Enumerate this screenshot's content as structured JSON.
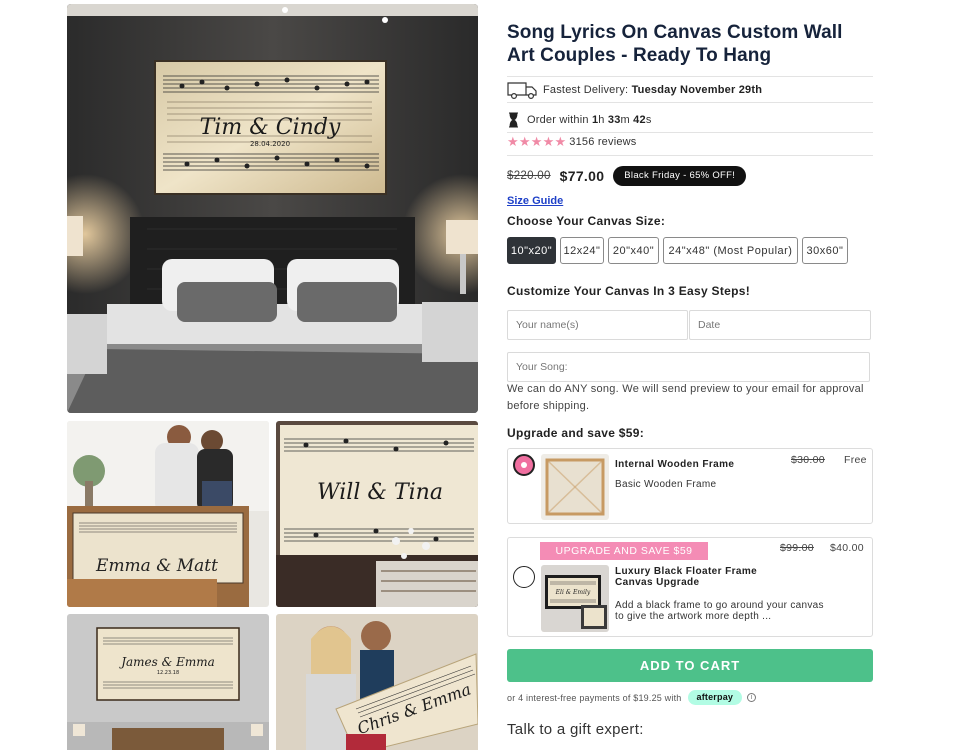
{
  "product": {
    "title": "Song Lyrics On Canvas Custom Wall Art Couples - Ready To Hang",
    "delivery": {
      "label": "Fastest Delivery:",
      "date": "Tuesday November 29th"
    },
    "order_timer": {
      "prefix": "Order within",
      "hours": "1",
      "h": "h",
      "minutes": "33",
      "m": "m",
      "seconds": "42",
      "s": "s"
    },
    "rating": {
      "stars": 5,
      "count_text": "3156 reviews"
    },
    "price": {
      "old": "$220.00",
      "new": "$77.00",
      "badge": "Black Friday - 65% OFF!"
    },
    "size_guide": "Size Guide",
    "size_label": "Choose Your Canvas Size:",
    "sizes": [
      "10\"x20\"",
      "12x24\"",
      "20\"x40\"",
      "24\"x48\" (Most Popular)",
      "30x60\""
    ],
    "selected_size": "10\"x20\"",
    "customize_label": "Customize Your Canvas In 3 Easy Steps!",
    "inputs": {
      "name_placeholder": "Your name(s)",
      "date_placeholder": "Date",
      "song_placeholder": "Your Song:"
    },
    "note": "We can do ANY song. We will send preview to your email for approval before shipping.",
    "upgrade_label": "Upgrade and save $59:",
    "upgrades": [
      {
        "title": "Internal Wooden Frame",
        "desc": "Basic Wooden Frame",
        "old_price": "$30.00",
        "new_price": "Free",
        "selected": true
      },
      {
        "ribbon": "UPGRADE AND SAVE $59",
        "title": "Luxury Black Floater Frame Canvas Upgrade",
        "desc": "Add a black frame to go around your canvas to give the artwork more depth ...",
        "old_price": "$99.00",
        "new_price": "$40.00",
        "selected": false
      }
    ],
    "add_to_cart": "ADD TO CART",
    "afterpay": {
      "text": "or 4 interest-free payments of $19.25 with",
      "badge": "afterpay",
      "info": "i"
    },
    "gift_expert": "Talk to a gift expert:"
  },
  "gallery": {
    "main_names": "Tim & Cindy",
    "main_date": "28.04.2020",
    "thumbs": [
      {
        "names": "Emma & Matt"
      },
      {
        "names": "Will & Tina"
      },
      {
        "names": "James & Emma",
        "date": "12.23.18"
      },
      {
        "names": "Chris & Emma"
      }
    ],
    "upgrade_thumb_names": "Eli & Emily"
  },
  "colors": {
    "accent_green": "#4dc18a",
    "pink": "#f48cb5",
    "title_navy": "#16233b",
    "badge_black": "#111111",
    "afterpay_mint": "#b2fce4"
  },
  "icons": [
    "truck-icon",
    "hourglass-icon",
    "star-icon",
    "info-icon"
  ]
}
